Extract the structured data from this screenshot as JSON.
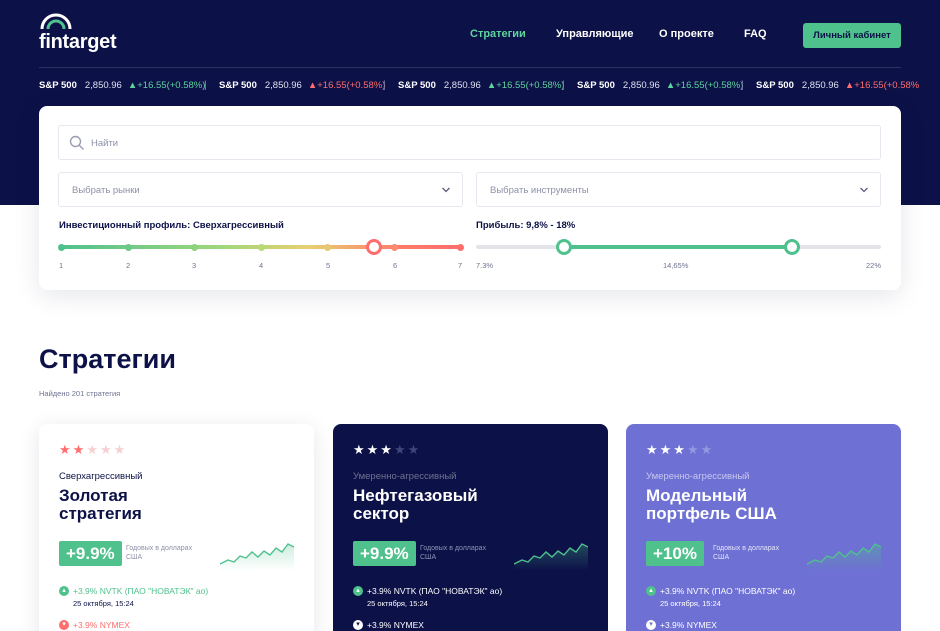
{
  "header": {
    "logo_text": "fintarget",
    "nav": [
      "Стратегии",
      "Управляющие",
      "О проекте",
      "FAQ"
    ],
    "cabinet_button": "Личный кабинет"
  },
  "ticker": [
    {
      "name": "S&P 500",
      "value": "2,850.96",
      "change": "+16.55(+0.58%)",
      "direction": "up"
    },
    {
      "name": "S&P 500",
      "value": "2,850.96",
      "change": "+16.55(+0.58%)",
      "direction": "down"
    },
    {
      "name": "S&P 500",
      "value": "2,850.96",
      "change": "+16.55(+0.58%)",
      "direction": "up"
    },
    {
      "name": "S&P 500",
      "value": "2,850.96",
      "change": "+16.55(+0.58%)",
      "direction": "up"
    },
    {
      "name": "S&P 500",
      "value": "2,850.96",
      "change": "+16.55(+0.58%)",
      "direction": "down"
    }
  ],
  "filters": {
    "search_placeholder": "Найти",
    "markets_placeholder": "Выбрать рынки",
    "instruments_placeholder": "Выбрать инструменты",
    "profile_label": "Инвестиционный профиль: Сверхагрессивный",
    "profile_ticks": [
      "1",
      "2",
      "3",
      "4",
      "5",
      "6",
      "7"
    ],
    "profile_value": 5.7,
    "profit_label": "Прибыль: 9,8% - 18%",
    "profit_ticks": [
      "7.3%",
      "14,65%",
      "22%"
    ],
    "profit_range": [
      9.8,
      18
    ]
  },
  "strategies": {
    "title": "Стратегии",
    "found": "Найдено 201 стратегия",
    "cards": [
      {
        "stars": 2,
        "profile": "Сверхагрессивный",
        "title_line1": "Золотая",
        "title_line2": "стратегия",
        "return": "+9.9%",
        "return_label": "Годовых в долларах США",
        "pos1_text": "+3.9% NVTK (ПАО \"НОВАТЭК\" ао)",
        "pos1_date": "25 октября, 15:24",
        "pos2_text": "+3.9% NYMEX"
      },
      {
        "stars": 3,
        "profile": "Умеренно-агрессивный",
        "title_line1": "Нефтегазовый",
        "title_line2": "сектор",
        "return": "+9.9%",
        "return_label": "Годовых в долларах США",
        "pos1_text": "+3.9% NVTK (ПАО \"НОВАТЭК\" ао)",
        "pos1_date": "25 октября, 15:24",
        "pos2_text": "+3.9% NYMEX"
      },
      {
        "stars": 3,
        "profile": "Умеренно-агрессивный",
        "title_line1": "Модельный",
        "title_line2": "портфель США",
        "return": "+10%",
        "return_label": "Годовых в долларах США",
        "pos1_text": "+3.9% NVTK (ПАО \"НОВАТЭК\" ао)",
        "pos1_date": "25 октября, 15:24",
        "pos2_text": "+3.9% NYMEX"
      }
    ]
  },
  "colors": {
    "navy": "#0c1147",
    "green": "#4fc18d",
    "red": "#ff6d6d",
    "purple": "#6e70d3"
  }
}
